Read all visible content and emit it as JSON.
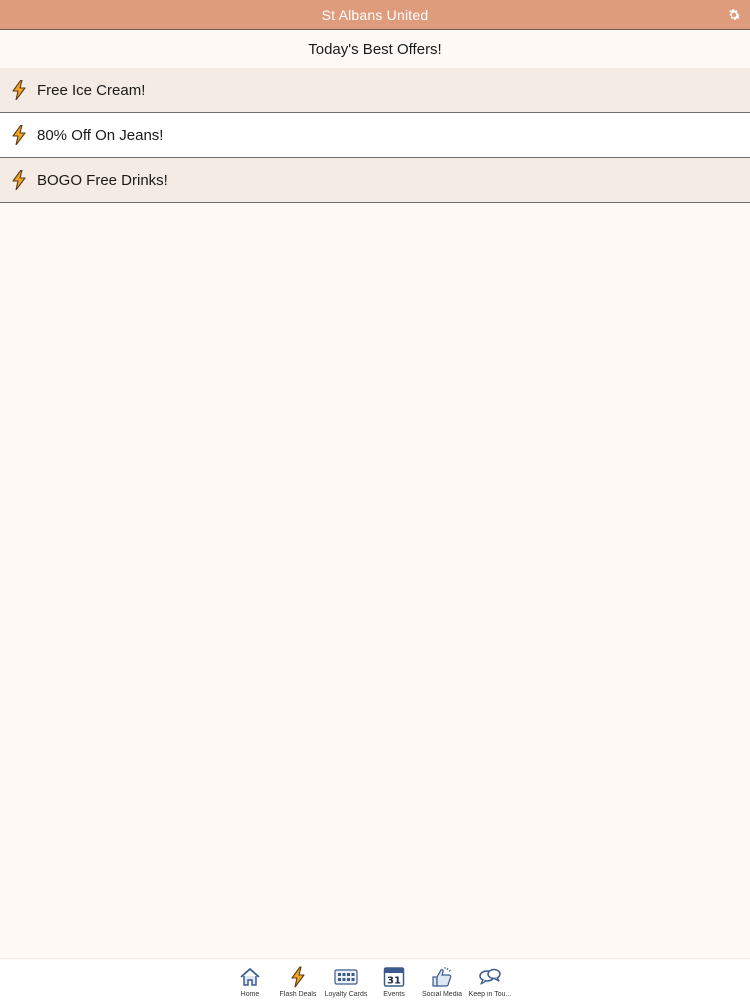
{
  "navbar": {
    "title": "St Albans United"
  },
  "page": {
    "title": "Today's Best Offers!"
  },
  "offers": [
    {
      "label": "Free Ice Cream!"
    },
    {
      "label": "80% Off On Jeans!"
    },
    {
      "label": "BOGO Free Drinks!"
    }
  ],
  "tabs": [
    {
      "label": "Home",
      "icon": "home-icon"
    },
    {
      "label": "Flash Deals",
      "icon": "lightning-bolt-icon"
    },
    {
      "label": "Loyalty Cards",
      "icon": "loyalty-card-icon"
    },
    {
      "label": "Events",
      "icon": "calendar-icon"
    },
    {
      "label": "Social Media",
      "icon": "thumbs-up-icon"
    },
    {
      "label": "Keep in Tou...",
      "icon": "chat-bubbles-icon"
    }
  ],
  "calendar": {
    "day": "31"
  },
  "colors": {
    "navbar": "#df9c7d",
    "bolt_fill": "#f5a623",
    "bolt_stroke": "#5a3a1a",
    "icon_blue": "#3b5b8c",
    "background": "#fffaf5"
  }
}
